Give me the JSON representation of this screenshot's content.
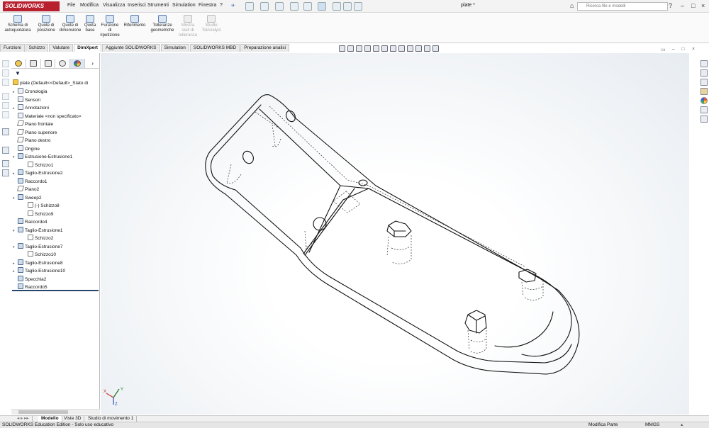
{
  "app": {
    "logo": "SOLIDWORKS",
    "document_title": "plate *"
  },
  "menu": [
    "File",
    "Modifica",
    "Visualizza",
    "Inserisci",
    "Strumenti",
    "Simulation",
    "Finestra",
    "?"
  ],
  "search": {
    "placeholder": "Ricerca file e modelli"
  },
  "window_buttons": {
    "help": "?",
    "minimize": "–",
    "restore": "□",
    "close": "×"
  },
  "commands": [
    {
      "label1": "Schema di",
      "label2": "autoquotatura",
      "label3": "",
      "enabled": true
    },
    {
      "label1": "Quote di",
      "label2": "posizione",
      "label3": "",
      "enabled": true
    },
    {
      "label1": "Quote di",
      "label2": "dimensione",
      "label3": "",
      "enabled": true
    },
    {
      "label1": "Quota",
      "label2": "base",
      "label3": "",
      "enabled": true
    },
    {
      "label1": "Funzione",
      "label2": "di",
      "label3": "ripetizione",
      "enabled": true
    },
    {
      "label1": "Riferimento",
      "label2": "",
      "label3": "",
      "enabled": true
    },
    {
      "label1": "Tolleranze",
      "label2": "geometriche",
      "label3": "",
      "enabled": true
    },
    {
      "label1": "Mostra",
      "label2": "stati di",
      "label3": "tolleranza",
      "enabled": false
    },
    {
      "label1": "Studio",
      "label2": "TolAnalyst",
      "label3": "",
      "enabled": false
    }
  ],
  "tabs": [
    "Funzioni",
    "Schizzo",
    "Valutare",
    "DimXpert",
    "Aggiunte SOLIDWORKS",
    "Simulation",
    "SOLIDWORKS MBD",
    "Preparazione analisi"
  ],
  "active_tab": "DimXpert",
  "tree": {
    "root": "plate  (Default<<Default>_Stato di",
    "items": [
      {
        "label": "Cronologia",
        "indent": 0,
        "toggle": "▸",
        "icon": "folder"
      },
      {
        "label": "Sensori",
        "indent": 0,
        "toggle": "",
        "icon": "sensor"
      },
      {
        "label": "Annotazioni",
        "indent": 0,
        "toggle": "▸",
        "icon": "annotation"
      },
      {
        "label": "Materiale <non specificato>",
        "indent": 0,
        "toggle": "",
        "icon": "material"
      },
      {
        "label": "Piano frontale",
        "indent": 0,
        "toggle": "",
        "icon": "plane"
      },
      {
        "label": "Piano superiore",
        "indent": 0,
        "toggle": "",
        "icon": "plane"
      },
      {
        "label": "Piano destro",
        "indent": 0,
        "toggle": "",
        "icon": "plane"
      },
      {
        "label": "Origine",
        "indent": 0,
        "toggle": "",
        "icon": "origin"
      },
      {
        "label": "Estrusione-Estrusione1",
        "indent": 0,
        "toggle": "▾",
        "icon": "feature"
      },
      {
        "label": "Schizzo1",
        "indent": 1,
        "toggle": "",
        "icon": "sketch"
      },
      {
        "label": "Taglio-Estrusione2",
        "indent": 0,
        "toggle": "▸",
        "icon": "feature"
      },
      {
        "label": "Raccordo1",
        "indent": 0,
        "toggle": "",
        "icon": "feature"
      },
      {
        "label": "Piano2",
        "indent": 0,
        "toggle": "",
        "icon": "plane"
      },
      {
        "label": "Sweep2",
        "indent": 0,
        "toggle": "▾",
        "icon": "feature"
      },
      {
        "label": "(-) Schizzo8",
        "indent": 1,
        "toggle": "",
        "icon": "sketch"
      },
      {
        "label": "Schizzo9",
        "indent": 1,
        "toggle": "",
        "icon": "sketch"
      },
      {
        "label": "Raccordo4",
        "indent": 0,
        "toggle": "",
        "icon": "feature"
      },
      {
        "label": "Taglio-Estrusione1",
        "indent": 0,
        "toggle": "▾",
        "icon": "feature"
      },
      {
        "label": "Schizzo2",
        "indent": 1,
        "toggle": "",
        "icon": "sketch"
      },
      {
        "label": "Taglio-Estrusione7",
        "indent": 0,
        "toggle": "▾",
        "icon": "feature"
      },
      {
        "label": "Schizzo10",
        "indent": 1,
        "toggle": "",
        "icon": "sketch"
      },
      {
        "label": "Taglio-Estrusione8",
        "indent": 0,
        "toggle": "▸",
        "icon": "feature"
      },
      {
        "label": "Taglio-Estrusione10",
        "indent": 0,
        "toggle": "▸",
        "icon": "feature"
      },
      {
        "label": "Specchia2",
        "indent": 0,
        "toggle": "",
        "icon": "feature"
      },
      {
        "label": "Raccordo5",
        "indent": 0,
        "toggle": "",
        "icon": "feature"
      }
    ]
  },
  "bottom_tabs": [
    "Modello",
    "Viste 3D",
    "Studio di movimento 1"
  ],
  "status": {
    "left": "SOLIDWORKS Education Edition - Solo uso educativo",
    "mode": "Modifica Parte",
    "units": "MMGS"
  },
  "colors": {
    "brand": "#b8202e",
    "rollback": "#27466f",
    "viewport_edge": "#e7ecf1"
  }
}
